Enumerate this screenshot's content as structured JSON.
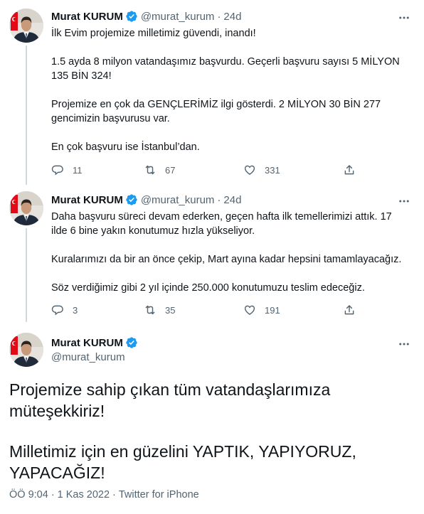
{
  "author": {
    "name": "Murat KURUM",
    "handle": "@murat_kurum"
  },
  "tweets": [
    {
      "handle": "@murat_kurum",
      "time": "24d",
      "lines": [
        "İlk Evim projemize milletimiz güvendi, inandı!",
        "1.5 ayda 8 milyon vatandaşımız başvurdu. Geçerli başvuru sayısı 5 MİLYON",
        "135 BİN 324!",
        "Projemize en çok da GENÇLERİMİZ ilgi gösterdi. 2 MİLYON 30 BİN 277",
        "gencimizin başvurusu var.",
        "En çok başvuru ise İstanbul’dan."
      ],
      "replies": "11",
      "retweets": "67",
      "likes": "331"
    },
    {
      "handle": "@murat_kurum",
      "time": "24d",
      "lines": [
        "Daha başvuru süreci devam ederken, geçen hafta ilk temellerimizi attık. 17",
        "ilde 6 bine yakın konutumuz hızla yükseliyor.",
        "Kuralarımızı da bir an önce çekip, Mart ayına kadar hepsini tamamlayacağız.",
        "Söz verdiğimiz gibi 2 yıl içinde 250.000 konutumuzu teslim edeceğiz."
      ],
      "replies": "3",
      "retweets": "35",
      "likes": "191"
    }
  ],
  "main_tweet": {
    "lines": [
      "Projemize sahip çıkan tüm vatandaşlarımıza",
      "müteşekkiriz!",
      "Milletimiz için en güzelini YAPTIK, YAPIYORUZ,",
      "YAPACAĞIZ!"
    ],
    "time": "ÖÖ 9:04",
    "date": "1 Kas 2022",
    "source": "Twitter for iPhone"
  },
  "colors": {
    "verified": "#1d9bf0",
    "secondary_text": "#536471",
    "primary_text": "#0f1419",
    "thread_line": "#cfd9de"
  },
  "icons": {
    "reply": "reply-icon",
    "retweet": "retweet-icon",
    "like": "heart-icon",
    "share": "share-icon",
    "more": "more-icon",
    "verified": "verified-badge-icon"
  }
}
